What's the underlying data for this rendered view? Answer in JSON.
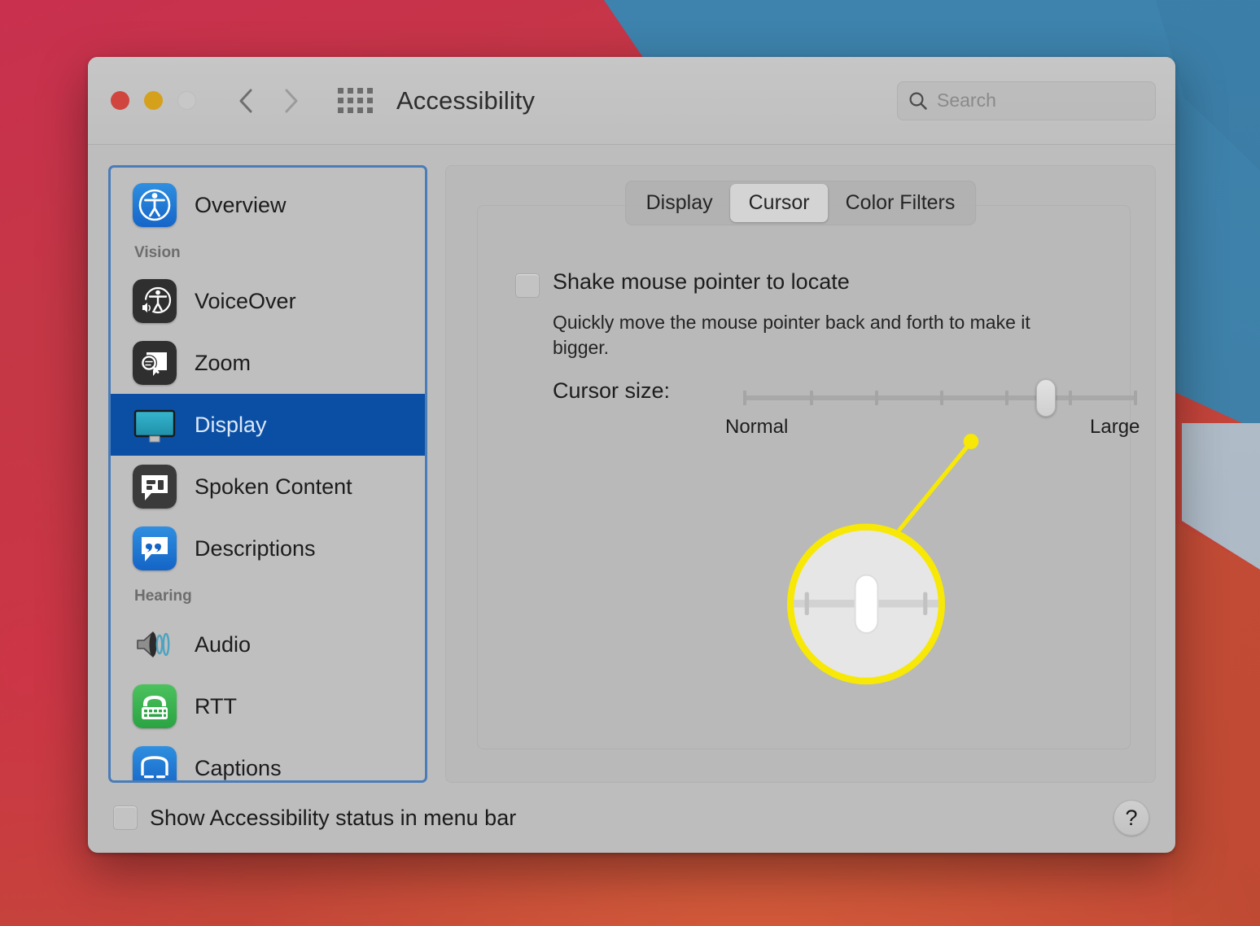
{
  "wallpaper": {
    "red": "#c33a42",
    "blue": "#3d83ad",
    "silver": "#b4c0cb",
    "orange": "#c44a36"
  },
  "window": {
    "title": "Accessibility",
    "traffic_lights": [
      {
        "name": "close",
        "color": "#d0453e"
      },
      {
        "name": "minimize",
        "color": "#d5a11b"
      },
      {
        "name": "zoom",
        "color": "#c7c7c7"
      }
    ],
    "nav": {
      "back": "back-icon",
      "forward": "forward-icon",
      "grid": "show-all-grid-icon"
    },
    "search": {
      "placeholder": "Search",
      "value": "",
      "icon": "search-icon"
    }
  },
  "sidebar": {
    "focus_ring_color": "#4a7cb8",
    "selection_color": "#0b4fa5",
    "items": [
      {
        "type": "item",
        "label": "Overview",
        "icon": "accessibility-icon",
        "selected": false
      },
      {
        "type": "group",
        "label": "Vision"
      },
      {
        "type": "item",
        "label": "VoiceOver",
        "icon": "voiceover-icon",
        "selected": false
      },
      {
        "type": "item",
        "label": "Zoom",
        "icon": "zoom-icon",
        "selected": false
      },
      {
        "type": "item",
        "label": "Display",
        "icon": "display-icon",
        "selected": true
      },
      {
        "type": "item",
        "label": "Spoken Content",
        "icon": "spoken-content-icon",
        "selected": false
      },
      {
        "type": "item",
        "label": "Descriptions",
        "icon": "descriptions-icon",
        "selected": false
      },
      {
        "type": "group",
        "label": "Hearing"
      },
      {
        "type": "item",
        "label": "Audio",
        "icon": "audio-icon",
        "selected": false
      },
      {
        "type": "item",
        "label": "RTT",
        "icon": "rtt-icon",
        "selected": false
      },
      {
        "type": "item",
        "label": "Captions",
        "icon": "captions-icon",
        "selected": false
      }
    ]
  },
  "main": {
    "tabs": [
      {
        "label": "Display",
        "active": false
      },
      {
        "label": "Cursor",
        "active": true
      },
      {
        "label": "Color Filters",
        "active": false
      }
    ],
    "shake": {
      "label": "Shake mouse pointer to locate",
      "description": "Quickly move the mouse pointer back and forth to make it bigger.",
      "checked": false
    },
    "cursor_size": {
      "label": "Cursor size:",
      "min_label": "Normal",
      "max_label": "Large",
      "ticks": 8,
      "value_index": 6,
      "value_percent": 77,
      "callout_color": "#f7e807"
    }
  },
  "footer": {
    "show_status_label": "Show Accessibility status in menu bar",
    "show_status_checked": false,
    "help_label": "?"
  }
}
